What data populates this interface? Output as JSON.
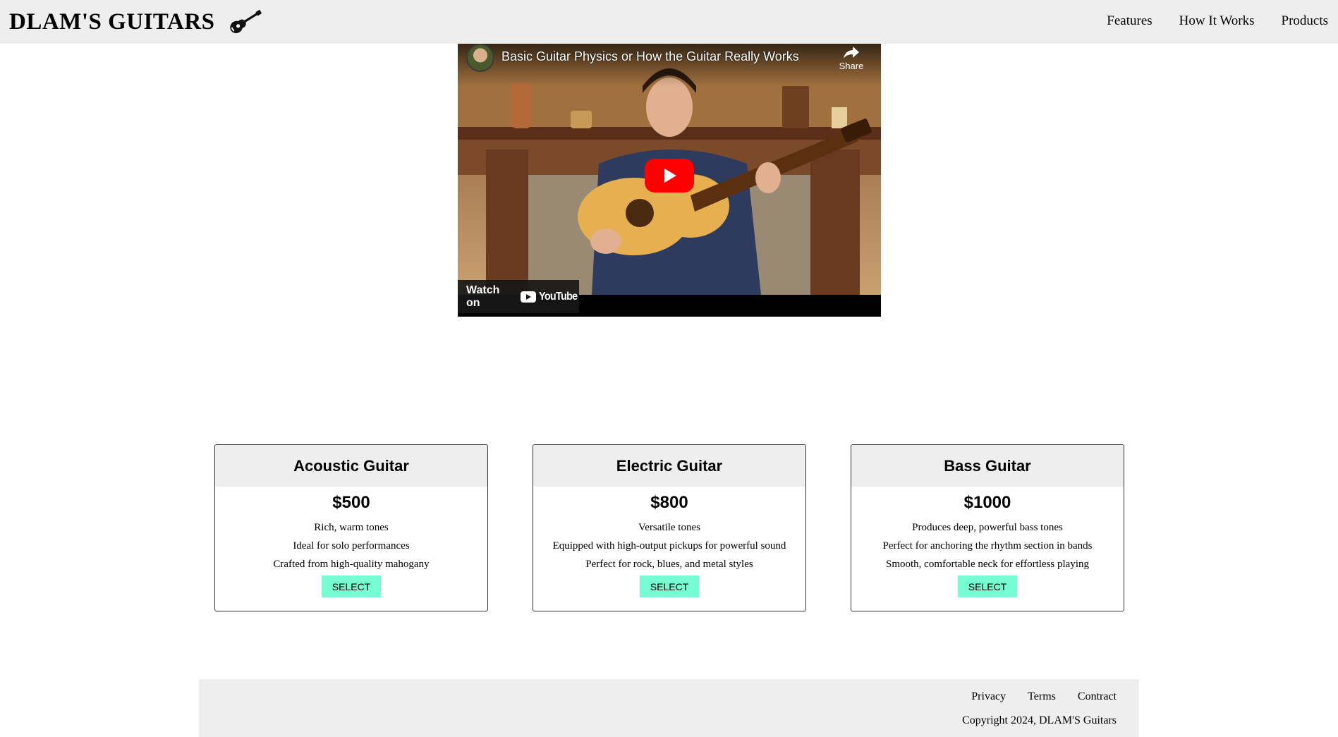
{
  "header": {
    "brand": "DLAM'S GUITARS",
    "logo_icon": "guitar-icon",
    "nav": [
      {
        "label": "Features"
      },
      {
        "label": "How It Works"
      },
      {
        "label": "Products"
      }
    ]
  },
  "video": {
    "title": "Basic Guitar Physics or How the Guitar Really Works",
    "share_label": "Share",
    "watch_on_label": "Watch on",
    "platform_logo_text": "YouTube",
    "play_button_color": "#ff0000"
  },
  "products": [
    {
      "title": "Acoustic Guitar",
      "price": "$500",
      "features": [
        "Rich, warm tones",
        "Ideal for solo performances",
        "Crafted from high-quality mahogany"
      ],
      "button": "SELECT"
    },
    {
      "title": "Electric Guitar",
      "price": "$800",
      "features": [
        "Versatile tones",
        "Equipped with high-output pickups for powerful sound",
        "Perfect for rock, blues, and metal styles"
      ],
      "button": "SELECT"
    },
    {
      "title": "Bass Guitar",
      "price": "$1000",
      "features": [
        "Produces deep, powerful bass tones",
        "Perfect for anchoring the rhythm section in bands",
        "Smooth, comfortable neck for effortless playing"
      ],
      "button": "SELECT"
    }
  ],
  "footer": {
    "links": [
      {
        "label": "Privacy"
      },
      {
        "label": "Terms"
      },
      {
        "label": "Contract"
      }
    ],
    "copyright": "Copyright 2024, DLAM'S Guitars"
  },
  "colors": {
    "header_bg": "#eeeeee",
    "button_bg": "#75fcd1",
    "card_head_bg": "#eeeeee",
    "footer_bg": "#eeeeee"
  }
}
